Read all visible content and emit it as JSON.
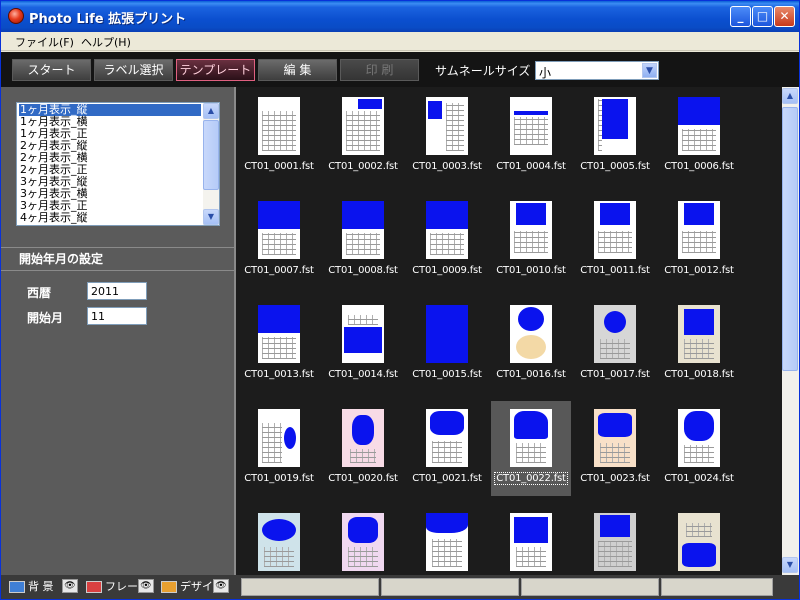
{
  "window": {
    "title": "Photo Life 拡張プリント",
    "min_label": "_",
    "max_label": "□",
    "close_label": "✕"
  },
  "menu": [
    {
      "label": "ファイル(F)"
    },
    {
      "label": "ヘルプ(H)"
    }
  ],
  "toolbar": {
    "buttons": [
      {
        "label": "スタート",
        "state": "normal"
      },
      {
        "label": "ラベル選択",
        "state": "normal"
      },
      {
        "label": "テンプレート",
        "state": "active"
      },
      {
        "label": "編 集",
        "state": "normal"
      },
      {
        "label": "印 刷",
        "state": "disabled"
      }
    ],
    "thumbnail_size_label": "サムネールサイズ",
    "thumbnail_size_value": "小"
  },
  "template_list": {
    "items": [
      "1ヶ月表示_縦",
      "1ヶ月表示_横",
      "1ヶ月表示_正",
      "2ヶ月表示_縦",
      "2ヶ月表示_横",
      "2ヶ月表示_正",
      "3ヶ月表示_縦",
      "3ヶ月表示_横",
      "3ヶ月表示_正",
      "4ヶ月表示_縦"
    ],
    "selected_index": 0
  },
  "start_settings": {
    "title": "開始年月の設定",
    "year_label": "西暦",
    "year_value": "2011",
    "month_label": "開始月",
    "month_value": "11"
  },
  "thumbnails": [
    {
      "name": "CT01_0001.fst",
      "style": "cal"
    },
    {
      "name": "CT01_0002.fst",
      "style": "sidebar"
    },
    {
      "name": "CT01_0003.fst",
      "style": "m1"
    },
    {
      "name": "CT01_0004.fst",
      "style": "table"
    },
    {
      "name": "CT01_0005.fst",
      "style": "bigblue"
    },
    {
      "name": "CT01_0006.fst",
      "style": "topblue"
    },
    {
      "name": "CT01_0007.fst",
      "style": "topblue"
    },
    {
      "name": "CT01_0008.fst",
      "style": "topblue"
    },
    {
      "name": "CT01_0009.fst",
      "style": "topblue"
    },
    {
      "name": "CT01_0010.fst",
      "style": "midblue"
    },
    {
      "name": "CT01_0011.fst",
      "style": "midblue"
    },
    {
      "name": "CT01_0012.fst",
      "style": "midblue"
    },
    {
      "name": "CT01_0013.fst",
      "style": "topblue"
    },
    {
      "name": "CT01_0014.fst",
      "style": "m1blue"
    },
    {
      "name": "CT01_0015.fst",
      "style": "book"
    },
    {
      "name": "CT01_0016.fst",
      "style": "circle"
    },
    {
      "name": "CT01_0017.fst",
      "style": "greycircle"
    },
    {
      "name": "CT01_0018.fst",
      "style": "beige"
    },
    {
      "name": "CT01_0019.fst",
      "style": "oval"
    },
    {
      "name": "CT01_0020.fst",
      "style": "heart"
    },
    {
      "name": "CT01_0021.fst",
      "style": "butterfly"
    },
    {
      "name": "CT01_0022.fst",
      "style": "elephant",
      "selected": true
    },
    {
      "name": "CT01_0023.fst",
      "style": "dog"
    },
    {
      "name": "CT01_0024.fst",
      "style": "rooster"
    },
    {
      "name": "",
      "style": "fish"
    },
    {
      "name": "",
      "style": "moth"
    },
    {
      "name": "",
      "style": "splash"
    },
    {
      "name": "",
      "style": "frame"
    },
    {
      "name": "",
      "style": "greybox"
    },
    {
      "name": "",
      "style": "m1beige"
    }
  ],
  "bottom_bar": {
    "items": [
      {
        "label": "背 景",
        "icon": "background-icon",
        "color": "#3f7fd6"
      },
      {
        "label": "フレーム",
        "icon": "frame-icon",
        "color": "#d94040"
      },
      {
        "label": "デザイン",
        "icon": "design-icon",
        "color": "#e8a030"
      }
    ],
    "eye_glyph": "👁"
  },
  "colors": {
    "accent_blue": "#0a13ee",
    "toolbar_bg": "#141414",
    "active_tab_border": "#e06080"
  }
}
